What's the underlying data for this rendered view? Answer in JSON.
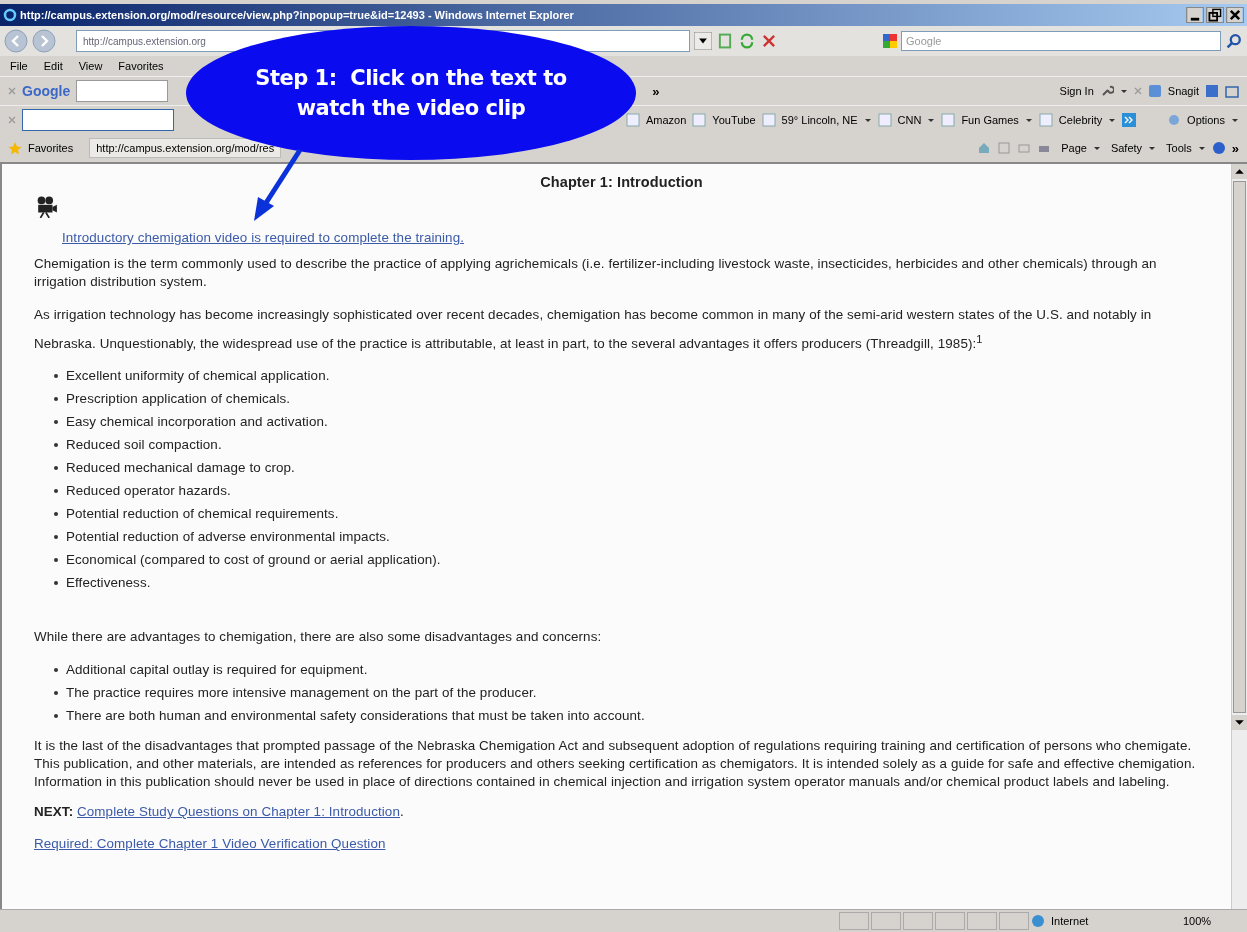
{
  "window": {
    "title": "http://campus.extension.org/mod/resource/view.php?inpopup=true&id=12493 - Windows Internet Explorer"
  },
  "address_bar": {
    "value": "http://campus.extension.org",
    "search_placeholder": "Google"
  },
  "menu": [
    "File",
    "Edit",
    "View",
    "Favorites"
  ],
  "google_toolbar": {
    "logo": "Google",
    "more": "»",
    "right": [
      "Sign In",
      "Snagit"
    ]
  },
  "links_toolbar": {
    "links": [
      {
        "label": "Amazon",
        "dropdown": false
      },
      {
        "label": "YouTube",
        "dropdown": false
      },
      {
        "label": "59° Lincoln, NE",
        "dropdown": true
      },
      {
        "label": "CNN",
        "dropdown": true
      },
      {
        "label": "Fun Games",
        "dropdown": true
      },
      {
        "label": "Celebrity",
        "dropdown": true
      }
    ],
    "options": "Options"
  },
  "favorites_bar": {
    "label": "Favorites",
    "tab": "http://campus.extension.org/mod/res",
    "commands": [
      "Page",
      "Safety",
      "Tools"
    ],
    "more": "»"
  },
  "callout": {
    "lines": [
      "Step 1:  Click on the text to",
      "watch the video clip"
    ]
  },
  "page": {
    "title": "Chapter 1: Introduction",
    "video_link": "Introductory chemigation video is required to complete the training.",
    "paragraphs": [
      "Chemigation is the term commonly used to describe the practice of applying agrichemicals (i.e. fertilizer-including livestock waste, insecticides, herbicides and other chemicals) through an irrigation distribution system.",
      "As irrigation technology has become increasingly sophisticated over recent decades, chemigation has become common in many of the semi-arid western states of the U.S. and notably in Nebraska. Unquestionably, the widespread use of the practice is attributable, at least in part, to the several advantages it offers producers (Threadgill, 1985):$^{1}$"
    ],
    "advantages": [
      "Excellent uniformity of chemical application.",
      "Prescription application of chemicals.",
      "Easy chemical incorporation and activation.",
      "Reduced soil compaction.",
      "Reduced mechanical damage to crop.",
      "Reduced operator hazards.",
      "Potential reduction of chemical requirements.",
      "Potential reduction of adverse environmental impacts.",
      "Economical (compared to cost of ground or aerial application).",
      "Effectiveness."
    ],
    "disadvantages_intro": "While there are advantages to chemigation, there are also some disadvantages and concerns:",
    "disadvantages": [
      "Additional capital outlay is required for equipment.",
      "The practice requires more intensive management on the part of the producer.",
      "There are both human and environmental safety considerations that must be taken into account."
    ],
    "closing": "It is the last of the disadvantages that prompted passage of the Nebraska Chemigation Act and subsequent adoption of regulations requiring training and certification of persons who chemigate. This publication, and other materials, are intended as references for producers and others seeking certification as chemigators. It is intended solely as a guide for safe and effective chemigation. Information in this publication should never be used in place of directions contained in chemical injection and irrigation system operator manuals and/or chemical product labels and labeling.",
    "next_label": "NEXT:",
    "next_link": "Complete Study Questions on Chapter 1: Introduction",
    "next_dot": ".",
    "required_link": "Required: Complete Chapter 1 Video Verification Question"
  },
  "status_bar": {
    "zone": "Internet",
    "zoom": "100%"
  }
}
